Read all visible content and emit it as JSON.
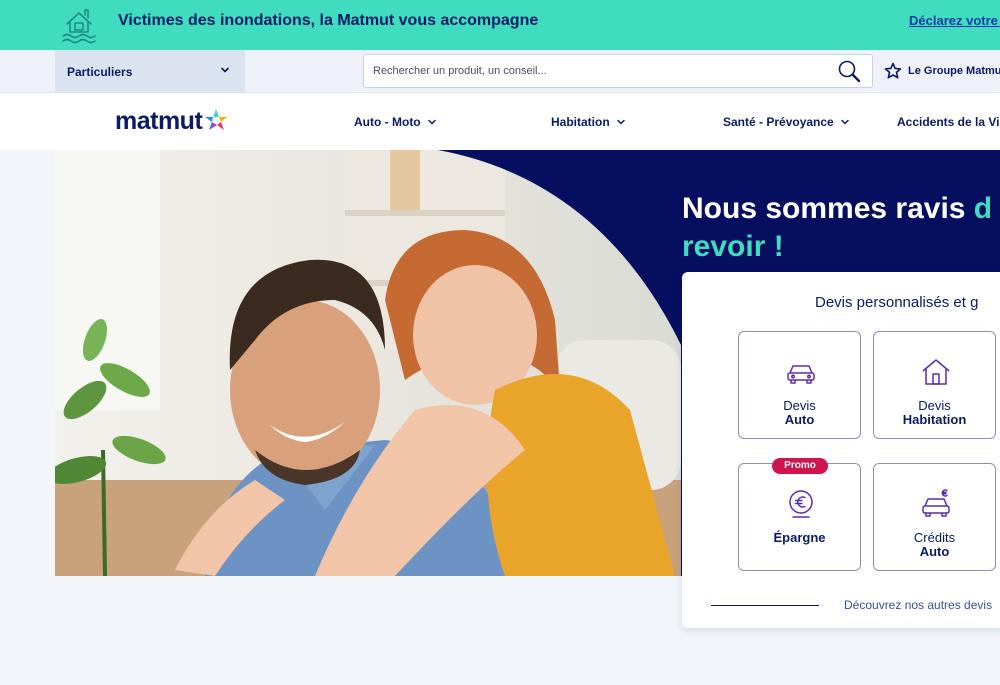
{
  "banner": {
    "text": "Victimes des inondations, la Matmut vous accompagne",
    "link": "Déclarez votre s",
    "icon": "flooded-house-icon",
    "bg_color": "#3fdcbf"
  },
  "utility": {
    "segment_label": "Particuliers",
    "search_placeholder": "Rechercher un produit, un conseil...",
    "groupe_label": "Le Groupe Matmut"
  },
  "nav": {
    "logo_text": "matmut",
    "items": [
      {
        "label": "Auto - Moto"
      },
      {
        "label": "Habitation"
      },
      {
        "label": "Santé - Prévoyance"
      },
      {
        "label": "Accidents de la Vie"
      }
    ]
  },
  "hero": {
    "title_line1": "Nous sommes ravis ",
    "title_accent1": "d",
    "title_line2": "revoir !",
    "navy_color": "#050e5f",
    "accent_color": "#3fdcbf"
  },
  "card": {
    "title": "Devis personnalisés et g",
    "tiles": [
      {
        "line1": "Devis",
        "line2": "Auto",
        "icon": "car-icon"
      },
      {
        "line1": "Devis",
        "line2": "Habitation",
        "icon": "house-icon"
      },
      {
        "label": "Épargne",
        "icon": "euro-coin-icon",
        "badge": "Promo"
      },
      {
        "line1": "Crédits",
        "line2": "Auto",
        "icon": "car-euro-icon"
      }
    ],
    "footer_link": "Découvrez nos autres devis",
    "badge_color": "#d0154e"
  }
}
